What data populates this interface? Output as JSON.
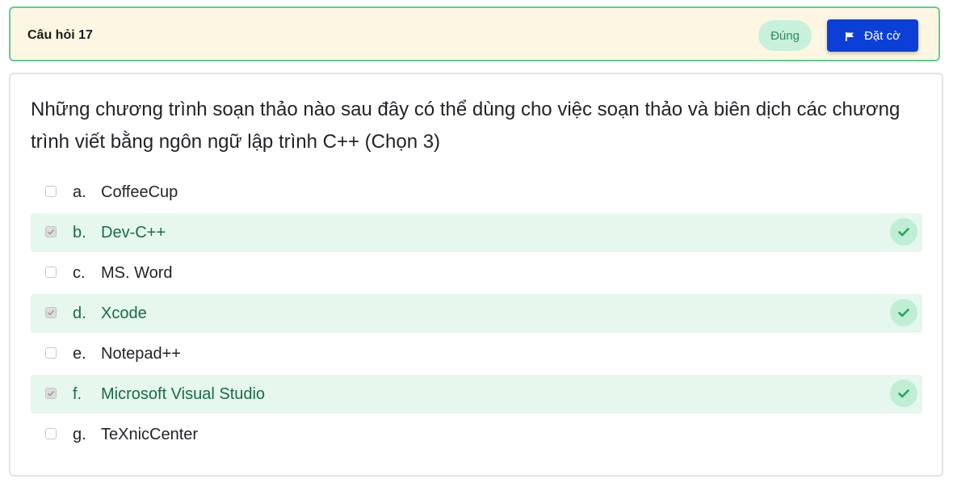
{
  "header": {
    "question_number": "Câu hỏi 17",
    "status": "Đúng",
    "flag_label": "Đặt cờ",
    "flag_icon": "flag-icon"
  },
  "question": {
    "text": "Những chương trình soạn thảo nào sau đây có thể dùng cho việc soạn thảo và biên dịch các chương trình viết bằng ngôn ngữ lập trình C++ (Chọn 3)"
  },
  "options": [
    {
      "letter": "a.",
      "label": "CoffeeCup",
      "checked": false,
      "correct": false
    },
    {
      "letter": "b.",
      "label": "Dev-C++",
      "checked": true,
      "correct": true
    },
    {
      "letter": "c.",
      "label": "MS. Word",
      "checked": false,
      "correct": false
    },
    {
      "letter": "d.",
      "label": "Xcode",
      "checked": true,
      "correct": true
    },
    {
      "letter": "e.",
      "label": "Notepad++",
      "checked": false,
      "correct": false
    },
    {
      "letter": "f.",
      "label": "Microsoft Visual Studio",
      "checked": true,
      "correct": true
    },
    {
      "letter": "g.",
      "label": "TeXnicCenter",
      "checked": false,
      "correct": false
    }
  ],
  "colors": {
    "header_bg": "#fdf6e2",
    "header_border": "#5fd08e",
    "flag_button_bg": "#0b3fd6",
    "status_bg": "#c8f1dc",
    "correct_row_bg": "#e6f7ee",
    "correct_check": "#27a55f"
  }
}
